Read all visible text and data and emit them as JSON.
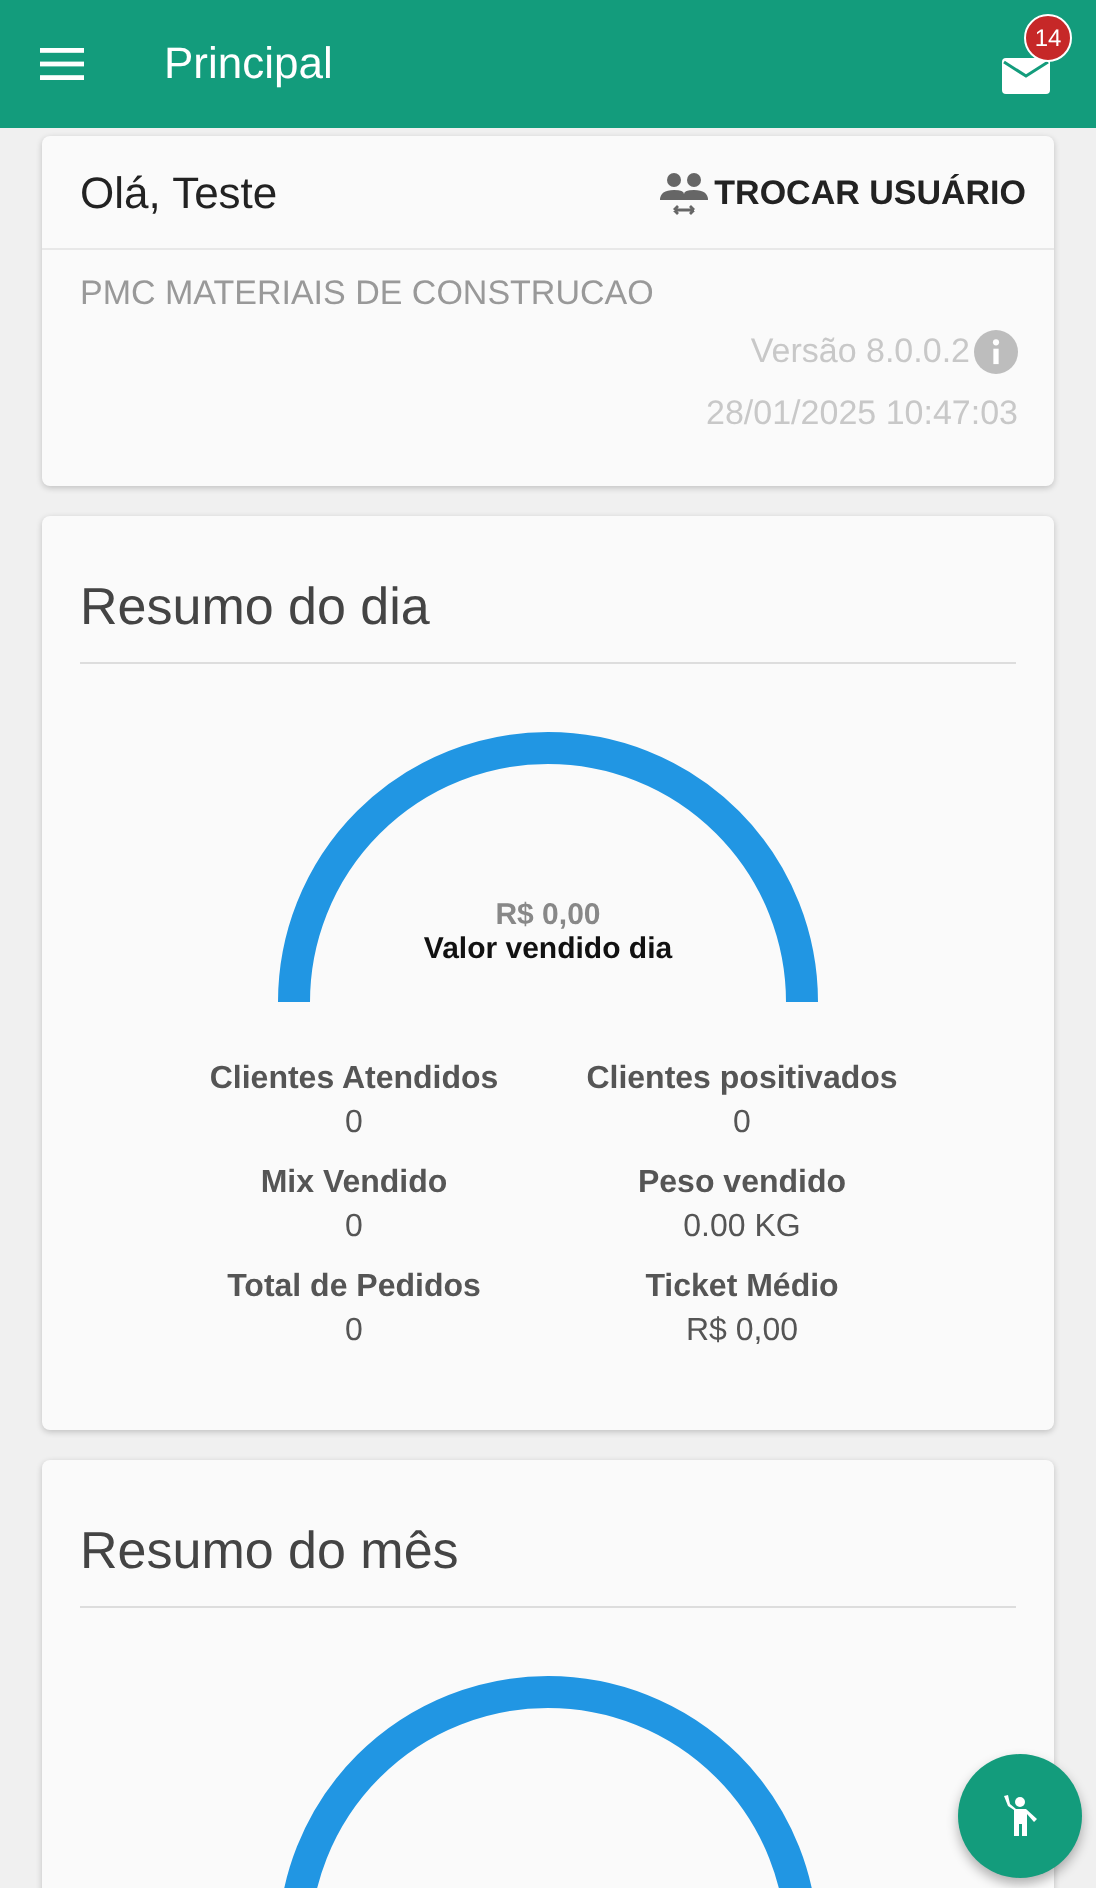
{
  "app_bar": {
    "title": "Principal",
    "notification_count": "14"
  },
  "user_card": {
    "greeting": "Olá, Teste",
    "switch_button": "TROCAR USUÁRIO",
    "company": "PMC MATERIAIS DE CONSTRUCAO",
    "version": "Versão 8.0.0.2",
    "datetime": "28/01/2025 10:47:03"
  },
  "day_summary": {
    "title": "Resumo do dia",
    "gauge_value": "R$ 0,00",
    "gauge_label": "Valor vendido dia",
    "stats": [
      {
        "label": "Clientes Atendidos",
        "value": "0"
      },
      {
        "label": "Clientes positivados",
        "value": "0"
      },
      {
        "label": "Mix Vendido",
        "value": "0"
      },
      {
        "label": "Peso vendido",
        "value": "0.00 KG"
      },
      {
        "label": "Total de Pedidos",
        "value": "0"
      },
      {
        "label": "Ticket Médio",
        "value": "R$ 0,00"
      }
    ]
  },
  "month_summary": {
    "title": "Resumo do mês"
  }
}
